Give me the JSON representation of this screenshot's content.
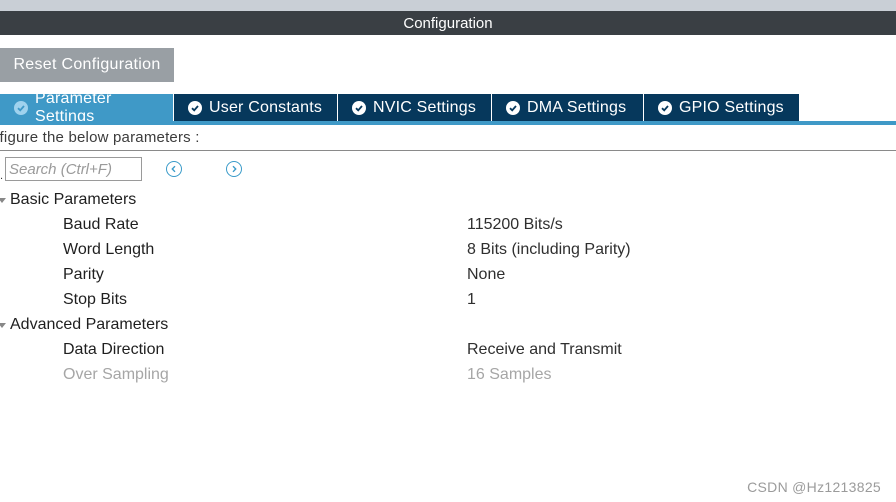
{
  "window": {
    "title": "Configuration"
  },
  "toolbar": {
    "reset_label": "Reset Configuration"
  },
  "tabs": [
    {
      "label": "Parameter Settings",
      "active": true
    },
    {
      "label": "User Constants",
      "active": false
    },
    {
      "label": "NVIC Settings",
      "active": false
    },
    {
      "label": "DMA Settings",
      "active": false
    },
    {
      "label": "GPIO Settings",
      "active": false
    }
  ],
  "instructions": "nfigure the below parameters :",
  "search": {
    "placeholder": "Search (Ctrl+F)",
    "value": ""
  },
  "groups": {
    "basic": {
      "label": "Basic Parameters",
      "params": [
        {
          "name": "Baud Rate",
          "value": "115200 Bits/s"
        },
        {
          "name": "Word Length",
          "value": "8 Bits (including Parity)"
        },
        {
          "name": "Parity",
          "value": "None"
        },
        {
          "name": "Stop Bits",
          "value": "1"
        }
      ]
    },
    "advanced": {
      "label": "Advanced Parameters",
      "params": [
        {
          "name": "Data Direction",
          "value": "Receive and Transmit",
          "enabled": true
        },
        {
          "name": "Over Sampling",
          "value": "16 Samples",
          "enabled": false
        }
      ]
    }
  },
  "watermark": "CSDN @Hz1213825",
  "colors": {
    "title_bar": "#3a3f44",
    "tab_active": "#3f99c7",
    "tab_inactive": "#06385c",
    "reset_button": "#999fa4",
    "disabled_text": "#a6a6a6"
  }
}
